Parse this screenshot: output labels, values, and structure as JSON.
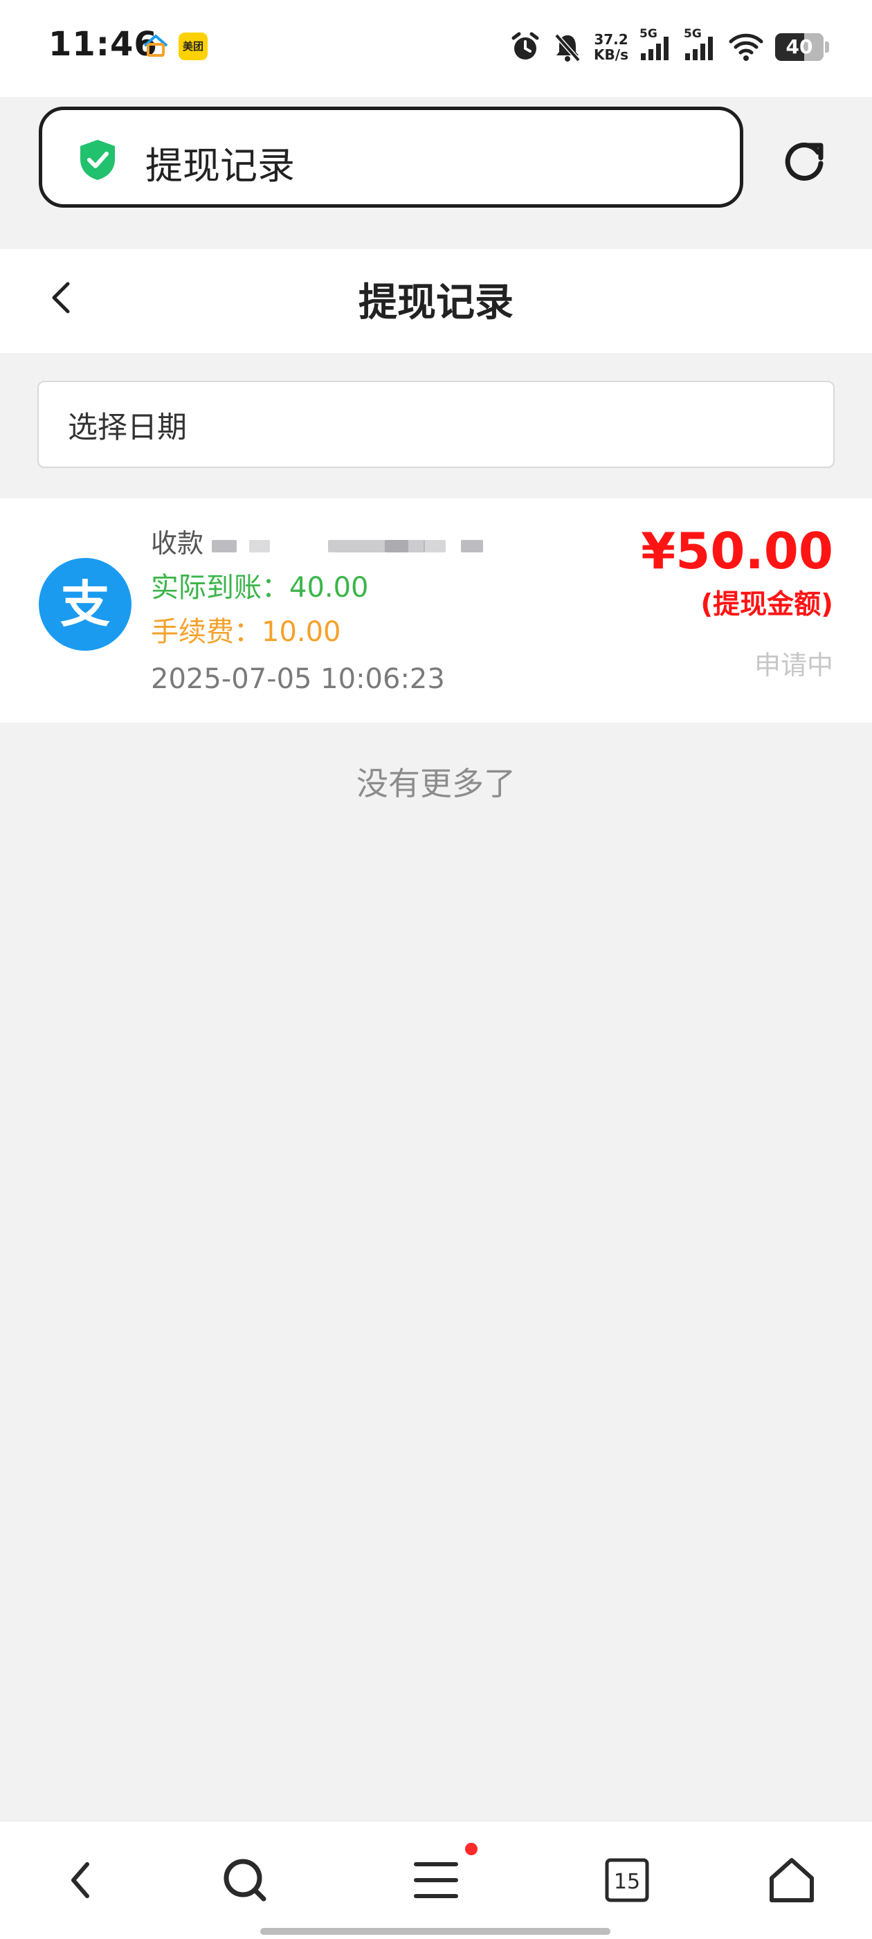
{
  "status_bar": {
    "time": "11:46",
    "app_badge": "美团",
    "net_speed_value": "37.2",
    "net_speed_unit": "KB/s",
    "sim1_label": "5G",
    "sim2_label": "5G",
    "battery": "40"
  },
  "browser": {
    "address_text": "提现记录",
    "tab_count": "15"
  },
  "header": {
    "title": "提现记录"
  },
  "filter": {
    "date_placeholder": "选择日期"
  },
  "record": {
    "payee_label": "收款",
    "actual_amount": "实际到账：40.00",
    "fee": "手续费：10.00",
    "timestamp": "2025-07-05 10:06:23",
    "amount": "¥50.00",
    "amount_caption": "(提现金额)",
    "status": "申请中",
    "payment_icon_char": "支"
  },
  "footer": {
    "no_more": "没有更多了"
  },
  "colors": {
    "actual_green": "#3bb54a",
    "fee_orange": "#f5a12b",
    "amount_red": "#ff1414",
    "alipay_blue": "#1a9bf0",
    "shield_green": "#22c16d"
  }
}
